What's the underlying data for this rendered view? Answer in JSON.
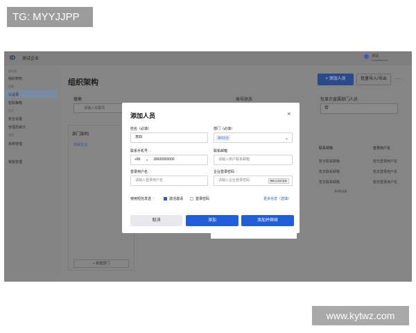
{
  "watermarks": {
    "top_left": "TG: MYYJJPP",
    "bottom_right": "www.kytwz.com"
  },
  "app": {
    "logo": "ID",
    "company": "测试企业",
    "user_name": "测试",
    "user_email": "xxxxxxxxxxxx"
  },
  "sidebar": {
    "sections": [
      "通讯录",
      "设备",
      "应用",
      "其他"
    ],
    "items": [
      "组织架构",
      "认证源",
      "密码策略",
      "安全设置",
      "管理员审计",
      "系统管理",
      "审批管理"
    ]
  },
  "main": {
    "title": "组织架构",
    "add_button": "+ 添加人员",
    "batch_button": "批量导入/导出",
    "more": "···",
    "search_label": "搜索",
    "search_placeholder": "请输入关键词",
    "status_label": "账号状态",
    "show_label": "仅显示直属部门人员",
    "show_value": "否",
    "org_title": "部门架构",
    "org_root": "测试企业",
    "org_add": "+ 新建部门",
    "columns": [
      "联系邮箱",
      "登录用户名"
    ],
    "rows": [
      [
        "暂无联系邮箱",
        "暂无登录用户名"
      ],
      [
        "暂无联系邮箱",
        "暂无登录用户名"
      ],
      [
        "暂无联系邮箱",
        "暂无登录用户名"
      ]
    ],
    "pager": "共3条记录"
  },
  "modal": {
    "title": "添加人员",
    "close": "×",
    "name_label": "姓名（必填）",
    "name_value": "李四",
    "dept_label": "部门（必填）",
    "dept_value": "测试企业",
    "phone_label": "联系手机号",
    "phone_prefix": "+86",
    "phone_value": "18600000000",
    "email_label": "联系邮箱",
    "email_placeholder": "请输入用户联系邮箱",
    "username_label": "登录用户名",
    "username_placeholder": "请输入登录用户名",
    "password_label": "企业登录密码",
    "password_placeholder": "请输入企业登录密码",
    "password_generate": "随机生成并复制",
    "sms_label": "使用短信发送",
    "opt_invite": "激活邀请",
    "opt_password": "登录密码",
    "more_link": "更多信息（选填）",
    "cancel": "取消",
    "add": "添加",
    "add_continue": "添加并继续"
  }
}
